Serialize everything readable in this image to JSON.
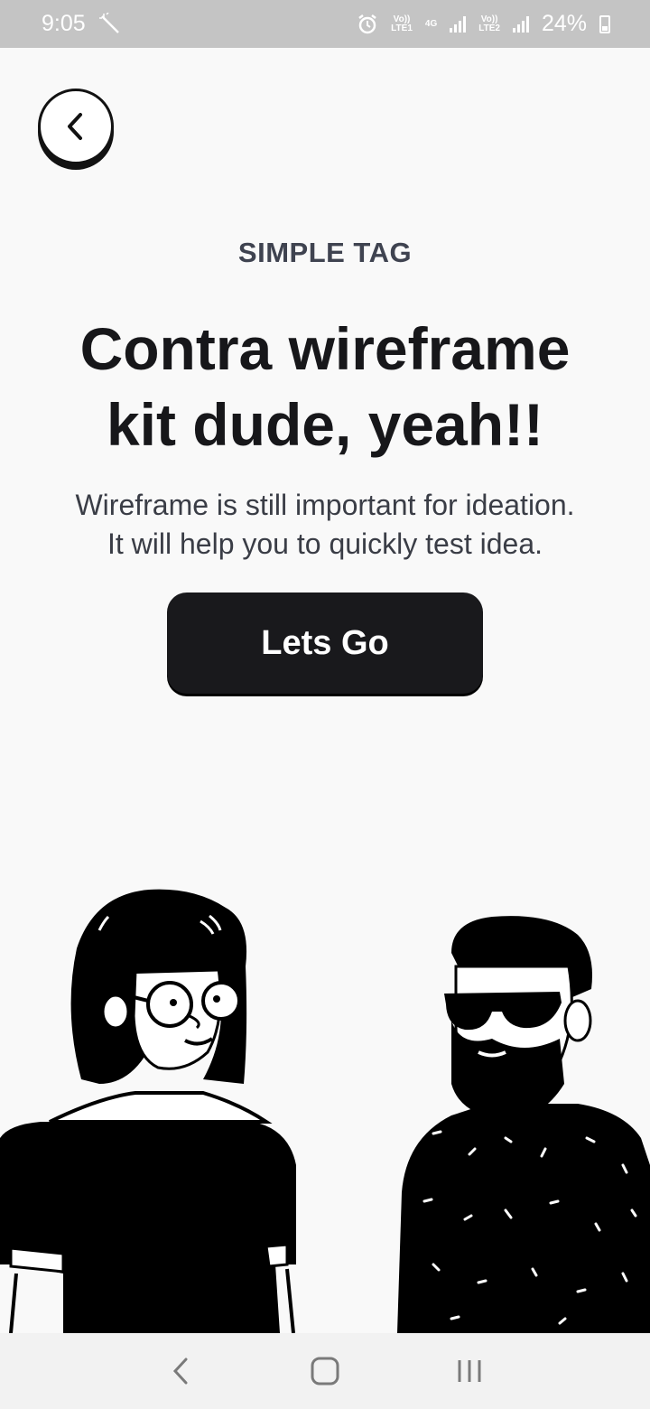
{
  "status_bar": {
    "time": "9:05",
    "sim1_volte": "Vo))",
    "sim1_lte": "LTE1",
    "network_type": "4G",
    "sim2_volte": "Vo))",
    "sim2_lte": "LTE2",
    "battery_percent": "24%",
    "icons": [
      "magic-wand-icon",
      "alarm-icon",
      "signal-icon",
      "battery-icon"
    ]
  },
  "header": {
    "back_icon": "chevron-left-icon"
  },
  "content": {
    "tag": "SIMPLE TAG",
    "headline_line1": "Contra wireframe",
    "headline_line2": "kit dude, yeah!!",
    "subtext_line1": "Wireframe is still important for ideation.",
    "subtext_line2": "It will help you to quickly test idea.",
    "cta_label": "Lets Go"
  },
  "illustration": {
    "figures": [
      "woman-with-glasses",
      "bearded-man-with-sunglasses"
    ]
  },
  "nav_bar": {
    "icons": [
      "back-nav-icon",
      "home-nav-icon",
      "recents-nav-icon"
    ]
  },
  "colors": {
    "background": "#f9f9f9",
    "text_dark": "#17171a",
    "tag_gray": "#3f4350",
    "button_dark": "#19191c",
    "status_bar": "#c4c4c4"
  }
}
